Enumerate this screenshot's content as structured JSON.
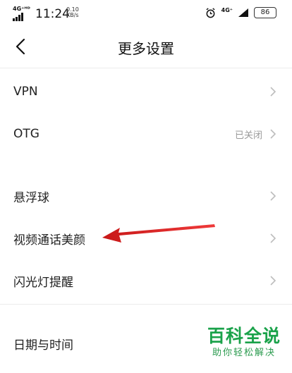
{
  "status_bar": {
    "network_left": "4G⁺ᴴᴰ",
    "time": "11:24",
    "speed_value": "0.10",
    "speed_unit": "KB/s",
    "network_right": "4G⁺",
    "battery": "86"
  },
  "header": {
    "title": "更多设置"
  },
  "rows": [
    {
      "label": "VPN",
      "status": ""
    },
    {
      "label": "OTG",
      "status": "已关闭"
    },
    {
      "label": "悬浮球",
      "status": ""
    },
    {
      "label": "视频通话美颜",
      "status": ""
    },
    {
      "label": "闪光灯提醒",
      "status": ""
    },
    {
      "label": "日期与时间",
      "status": ""
    }
  ],
  "watermark": {
    "main": "百科全说",
    "sub": "助你轻松解决"
  },
  "colors": {
    "annotation_arrow": "#e02020",
    "watermark_green": "#1aa24a"
  }
}
